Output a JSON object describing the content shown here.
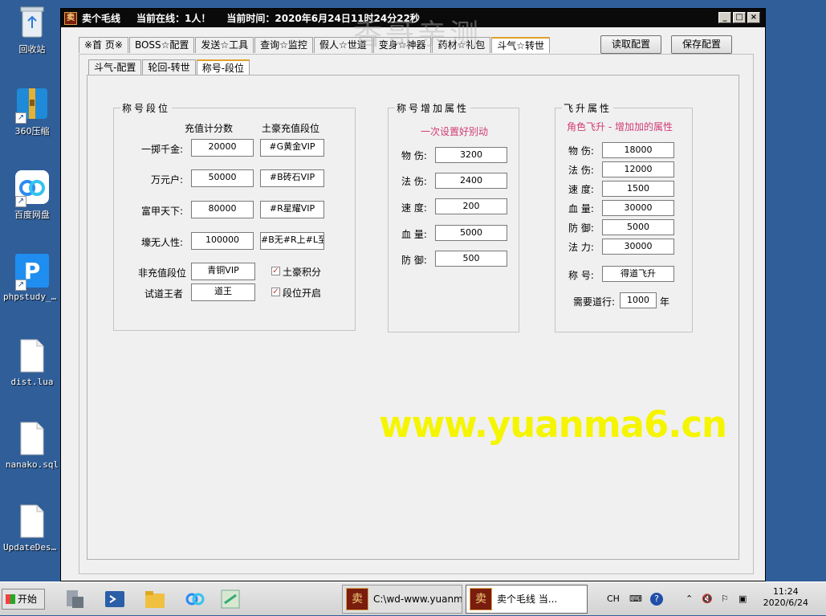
{
  "desktop": {
    "icons": [
      {
        "label": "回收站",
        "icon": "recycle-bin-icon"
      },
      {
        "label": "360压缩",
        "icon": "360-zip-icon"
      },
      {
        "label": "百度网盘",
        "icon": "baidu-netdisk-icon"
      },
      {
        "label": "phpstudy_pro",
        "icon": "phpstudy-icon"
      },
      {
        "label": "dist.lua",
        "icon": "file-icon"
      },
      {
        "label": "nanako.sql",
        "icon": "file-icon"
      },
      {
        "label": "UpdateDes...",
        "icon": "file-icon"
      }
    ]
  },
  "window": {
    "title": "卖个毛线",
    "online": "当前在线：1人！",
    "time": "当前时间：2020年6月24日11时24分22秒",
    "controls": {
      "minimize": "_",
      "maximize": "□",
      "close": "×"
    },
    "tabs": [
      "※首 页※",
      "BOSS☆配置",
      "发送☆工具",
      "查询☆监控",
      "假人☆世道",
      "变身☆神器",
      "药材☆礼包",
      "斗气☆转世"
    ],
    "active_tab": "斗气☆转世",
    "buttons": {
      "read": "读取配置",
      "save": "保存配置"
    },
    "subtabs": [
      "斗气-配置",
      "轮回-转世",
      "称号-段位"
    ],
    "active_subtab": "称号-段位"
  },
  "ranks": {
    "title": "称号段位",
    "col_score": "充值计分数",
    "col_rank": "土豪充值段位",
    "rows": [
      {
        "label": "一掷千金:",
        "score": "20000",
        "rank": "#G黄金VIP"
      },
      {
        "label": "万元户:",
        "score": "50000",
        "rank": "#B砖石VIP"
      },
      {
        "label": "富甲天下:",
        "score": "80000",
        "rank": "#R星耀VIP"
      },
      {
        "label": "壕无人性:",
        "score": "100000",
        "rank": "#B无#R上#L至#"
      }
    ],
    "nonpay_label": "非充值段位",
    "nonpay_value": "青铜VIP",
    "trial_label": "试道王者",
    "trial_value": "道王",
    "chk1": "土豪积分",
    "chk2": "段位开启",
    "check_mark": "✓"
  },
  "title_attrs": {
    "title": "称号增加属性",
    "note": "一次设置好别动",
    "rows": [
      {
        "label": "物 伤:",
        "value": "3200"
      },
      {
        "label": "法 伤:",
        "value": "2400"
      },
      {
        "label": "速 度:",
        "value": "200"
      },
      {
        "label": "血 量:",
        "value": "5000"
      },
      {
        "label": "防 御:",
        "value": "500"
      }
    ]
  },
  "ascend": {
    "title": "飞升属性",
    "note": "角色飞升 - 增加加的属性",
    "rows": [
      {
        "label": "物 伤:",
        "value": "18000"
      },
      {
        "label": "法 伤:",
        "value": "12000"
      },
      {
        "label": "速 度:",
        "value": "1500"
      },
      {
        "label": "血 量:",
        "value": "30000"
      },
      {
        "label": "防 御:",
        "value": "5000"
      },
      {
        "label": "法 力:",
        "value": "30000"
      }
    ],
    "name_label": "称 号:",
    "name_value": "得道飞升",
    "req_label": "需要道行:",
    "req_value": "1000",
    "req_unit": "年"
  },
  "watermark": {
    "text": "香哥亲测",
    "url": "www.yuanma6.cn"
  },
  "taskbar": {
    "start": "开始",
    "tasks": [
      {
        "label": "C:\\wd-www.yuanm...",
        "active": false
      },
      {
        "label": "卖个毛线    当...",
        "active": true
      }
    ],
    "lang": "CH",
    "time": "11:24",
    "date": "2020/6/24"
  }
}
